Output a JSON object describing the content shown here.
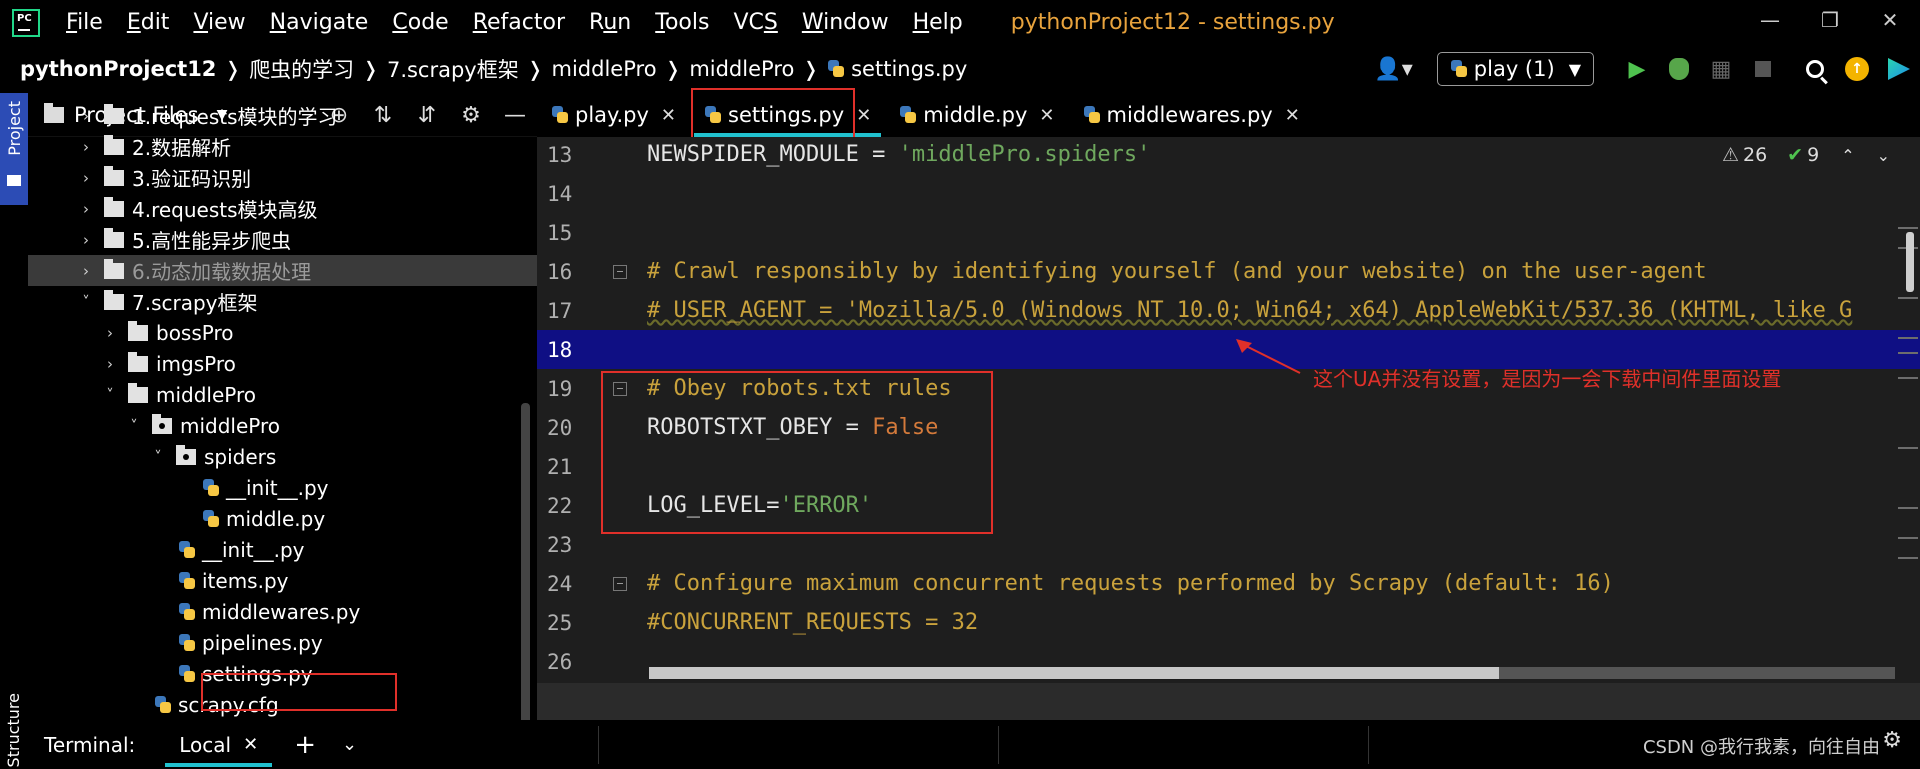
{
  "menubar": {
    "logo_text": "PC",
    "items": [
      {
        "pre": "",
        "key": "F",
        "post": "ile"
      },
      {
        "pre": "",
        "key": "E",
        "post": "dit"
      },
      {
        "pre": "",
        "key": "V",
        "post": "iew"
      },
      {
        "pre": "",
        "key": "N",
        "post": "avigate"
      },
      {
        "pre": "",
        "key": "C",
        "post": "ode"
      },
      {
        "pre": "",
        "key": "R",
        "post": "efactor"
      },
      {
        "pre": "R",
        "key": "u",
        "post": "n"
      },
      {
        "pre": "",
        "key": "T",
        "post": "ools"
      },
      {
        "pre": "VC",
        "key": "S",
        "post": ""
      },
      {
        "pre": "",
        "key": "W",
        "post": "indow"
      },
      {
        "pre": "",
        "key": "H",
        "post": "elp"
      }
    ],
    "window_title": "pythonProject12 - settings.py"
  },
  "navbar": {
    "crumbs": [
      "pythonProject12",
      "爬虫的学习",
      "7.scrapy框架",
      "middlePro",
      "middlePro"
    ],
    "file": "settings.py",
    "run_config": "play (1)"
  },
  "project_panel": {
    "title": "Project Files",
    "side_tab_project": "Project",
    "side_tab_structure": "Structure",
    "tree": [
      {
        "label": "1.requests模块的学习",
        "indent": 0,
        "arrow": ">",
        "kind": "folder"
      },
      {
        "label": "2.数据解析",
        "indent": 0,
        "arrow": ">",
        "kind": "folder"
      },
      {
        "label": "3.验证码识别",
        "indent": 0,
        "arrow": ">",
        "kind": "folder"
      },
      {
        "label": "4.requests模块高级",
        "indent": 0,
        "arrow": ">",
        "kind": "folder"
      },
      {
        "label": "5.高性能异步爬虫",
        "indent": 0,
        "arrow": ">",
        "kind": "folder"
      },
      {
        "label": "6.动态加载数据处理",
        "indent": 0,
        "arrow": ">",
        "kind": "folder",
        "selected": true
      },
      {
        "label": "7.scrapy框架",
        "indent": 0,
        "arrow": "v",
        "kind": "folder"
      },
      {
        "label": "bossPro",
        "indent": 1,
        "arrow": ">",
        "kind": "folder"
      },
      {
        "label": "imgsPro",
        "indent": 1,
        "arrow": ">",
        "kind": "folder"
      },
      {
        "label": "middlePro",
        "indent": 1,
        "arrow": "v",
        "kind": "folder"
      },
      {
        "label": "middlePro",
        "indent": 2,
        "arrow": "v",
        "kind": "package"
      },
      {
        "label": "spiders",
        "indent": 3,
        "arrow": "v",
        "kind": "package"
      },
      {
        "label": "__init__.py",
        "indent": 4,
        "arrow": "",
        "kind": "py"
      },
      {
        "label": "middle.py",
        "indent": 4,
        "arrow": "",
        "kind": "py"
      },
      {
        "label": "__init__.py",
        "indent": 3,
        "arrow": "",
        "kind": "py"
      },
      {
        "label": "items.py",
        "indent": 3,
        "arrow": "",
        "kind": "py"
      },
      {
        "label": "middlewares.py",
        "indent": 3,
        "arrow": "",
        "kind": "py"
      },
      {
        "label": "pipelines.py",
        "indent": 3,
        "arrow": "",
        "kind": "py"
      },
      {
        "label": "settings.py",
        "indent": 3,
        "arrow": "",
        "kind": "py"
      },
      {
        "label": "scrapy.cfg",
        "indent": 2,
        "arrow": "",
        "kind": "py"
      }
    ]
  },
  "editor_tabs": [
    {
      "label": "play.py",
      "active": false
    },
    {
      "label": "settings.py",
      "active": true
    },
    {
      "label": "middle.py",
      "active": false
    },
    {
      "label": "middlewares.py",
      "active": false
    }
  ],
  "editor": {
    "warnings": "26",
    "checks": "9",
    "annotation": "这个UA并没有设置，是因为一会下载中间件里面设置",
    "lines": [
      {
        "n": "13",
        "parts": [
          {
            "t": "NEWSPIDER_MODULE = ",
            "c": "c-normal"
          },
          {
            "t": "'middlePro.spiders'",
            "c": "c-string"
          }
        ]
      },
      {
        "n": "14",
        "parts": []
      },
      {
        "n": "15",
        "parts": []
      },
      {
        "n": "16",
        "fold": true,
        "parts": [
          {
            "t": "# Crawl responsibly by identifying yourself (and your website) on the user-agent",
            "c": "c-comment"
          }
        ]
      },
      {
        "n": "17",
        "parts": [
          {
            "t": "# USER_AGENT = 'Mozilla/5.0 (Windows NT 10.0; Win64; x64) AppleWebKit/537.36 (KHTML, like G",
            "c": "c-ua"
          }
        ]
      },
      {
        "n": "18",
        "caret": true,
        "parts": []
      },
      {
        "n": "19",
        "fold": true,
        "parts": [
          {
            "t": "# Obey robots.txt rules",
            "c": "c-comment"
          }
        ]
      },
      {
        "n": "20",
        "parts": [
          {
            "t": "ROBOTSTXT_OBEY = ",
            "c": "c-normal"
          },
          {
            "t": "False",
            "c": "c-const"
          }
        ]
      },
      {
        "n": "21",
        "parts": []
      },
      {
        "n": "22",
        "parts": [
          {
            "t": "LOG_LEVEL=",
            "c": "c-normal"
          },
          {
            "t": "'ERROR'",
            "c": "c-string"
          }
        ]
      },
      {
        "n": "23",
        "parts": []
      },
      {
        "n": "24",
        "fold": true,
        "parts": [
          {
            "t": "# Configure maximum concurrent requests performed by Scrapy (default: 16)",
            "c": "c-comment"
          }
        ]
      },
      {
        "n": "25",
        "parts": [
          {
            "t": "#CONCURRENT_REQUESTS = 32",
            "c": "c-comment"
          }
        ]
      },
      {
        "n": "26",
        "parts": []
      }
    ]
  },
  "terminal": {
    "label": "Terminal:",
    "tab": "Local",
    "watermark": "CSDN @我行我素，向往自由"
  }
}
